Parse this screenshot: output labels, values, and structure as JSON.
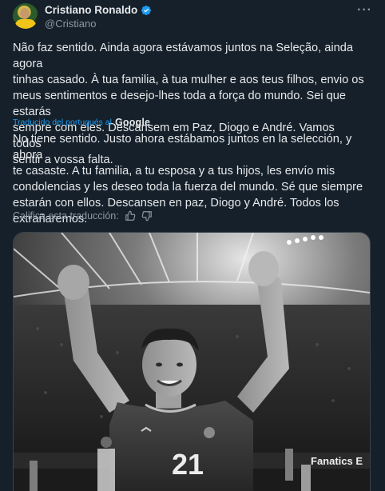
{
  "author": {
    "name": "Cristiano Ronaldo",
    "handle": "@Cristiano",
    "verified": true
  },
  "tweet": {
    "text": "Não faz sentido. Ainda agora estávamos juntos na Seleção, ainda agora\ntinhas casado. À tua familia, à tua mulher e aos teus filhos, envio os\nmeus sentimentos e desejo-lhes toda a força do mundo. Sei que estarás\nsempre com eles. Descansem em Paz, Diogo e André. Vamos todos\nsentir a vossa falta."
  },
  "translation": {
    "label": "Traducido del portugués al",
    "provider": "Google",
    "text": "No tiene sentido. Justo ahora estábamos juntos en la selección, y ahora\nte casaste. A tu familia, a tu esposa y a tus hijos, les envío mis\ncondolencias y les deseo toda la fuerza del mundo. Sé que siempre\nestarán con ellos. Descansen en paz, Diogo y André. Todos los\nextrañaremos.",
    "rate_label": "Califica esta traducción:"
  },
  "media": {
    "jersey_number": "21",
    "ad_board": "Fanatics E"
  },
  "colors": {
    "background": "#15202b",
    "text": "#e7e9ea",
    "secondary": "#8b98a5",
    "accent": "#1d9bf0"
  },
  "icons": [
    "more-icon",
    "verified-icon",
    "thumbs-up-icon",
    "thumbs-down-icon"
  ]
}
